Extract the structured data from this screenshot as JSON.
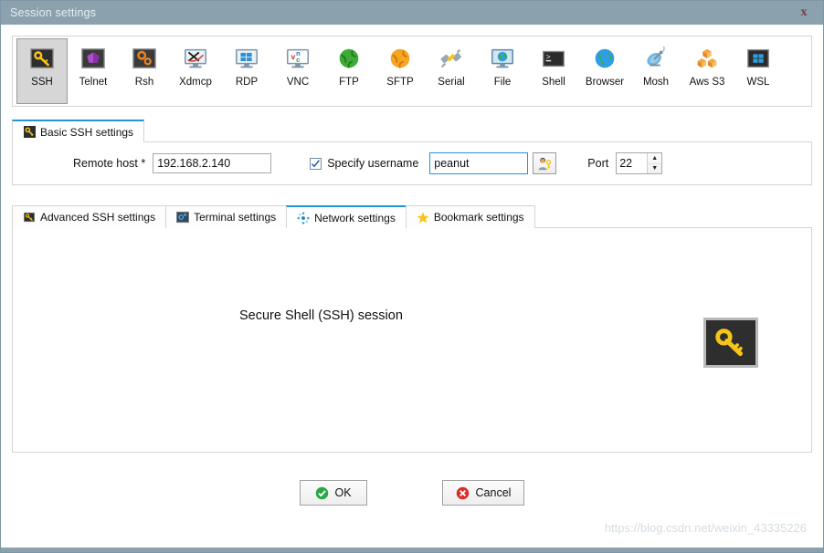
{
  "window": {
    "title": "Session settings",
    "close_label": "x"
  },
  "session_types": [
    {
      "id": "ssh",
      "label": "SSH",
      "icon": "key-icon",
      "selected": true
    },
    {
      "id": "telnet",
      "label": "Telnet",
      "icon": "purple-cube-icon",
      "selected": false
    },
    {
      "id": "rsh",
      "label": "Rsh",
      "icon": "orange-gears-icon",
      "selected": false
    },
    {
      "id": "xdmcp",
      "label": "Xdmcp",
      "icon": "x-monitor-icon",
      "selected": false
    },
    {
      "id": "rdp",
      "label": "RDP",
      "icon": "windows-monitor-icon",
      "selected": false
    },
    {
      "id": "vnc",
      "label": "VNC",
      "icon": "vnc-monitor-icon",
      "selected": false
    },
    {
      "id": "ftp",
      "label": "FTP",
      "icon": "green-globe-icon",
      "selected": false
    },
    {
      "id": "sftp",
      "label": "SFTP",
      "icon": "orange-globe-icon",
      "selected": false
    },
    {
      "id": "serial",
      "label": "Serial",
      "icon": "plug-connector-icon",
      "selected": false
    },
    {
      "id": "file",
      "label": "File",
      "icon": "globe-monitor-icon",
      "selected": false
    },
    {
      "id": "shell",
      "label": "Shell",
      "icon": "terminal-icon",
      "selected": false
    },
    {
      "id": "browser",
      "label": "Browser",
      "icon": "blue-globe-icon",
      "selected": false
    },
    {
      "id": "mosh",
      "label": "Mosh",
      "icon": "satellite-dish-icon",
      "selected": false
    },
    {
      "id": "awss3",
      "label": "Aws S3",
      "icon": "orange-cubes-icon",
      "selected": false
    },
    {
      "id": "wsl",
      "label": "WSL",
      "icon": "windows-logo-icon",
      "selected": false
    }
  ],
  "basic_tab": {
    "label": "Basic SSH settings",
    "icon": "key-icon"
  },
  "form": {
    "remote_host_label": "Remote host *",
    "remote_host_value": "192.168.2.140",
    "specify_username_label": "Specify username",
    "specify_username_checked": true,
    "username_value": "peanut",
    "user_key_button_icon": "user-key-icon",
    "port_label": "Port",
    "port_value": "22"
  },
  "settings_tabs": [
    {
      "label": "Advanced SSH settings",
      "icon": "key-icon",
      "active": false
    },
    {
      "label": "Terminal settings",
      "icon": "terminal-settings-icon",
      "active": false
    },
    {
      "label": "Network settings",
      "icon": "network-nodes-icon",
      "active": true
    },
    {
      "label": "Bookmark settings",
      "icon": "star-icon",
      "active": false
    }
  ],
  "content": {
    "text": "Secure Shell (SSH) session",
    "icon": "key-icon"
  },
  "footer": {
    "ok_label": "OK",
    "cancel_label": "Cancel",
    "ok_icon": "green-check-icon",
    "cancel_icon": "red-x-icon"
  },
  "watermark": "https://blog.csdn.net/weixin_43335226",
  "colors": {
    "titlebar": "#8ba2ae",
    "accent": "#2196d6",
    "ok_green": "#27a844",
    "cancel_red": "#e02b27",
    "key_yellow": "#f5c518"
  }
}
